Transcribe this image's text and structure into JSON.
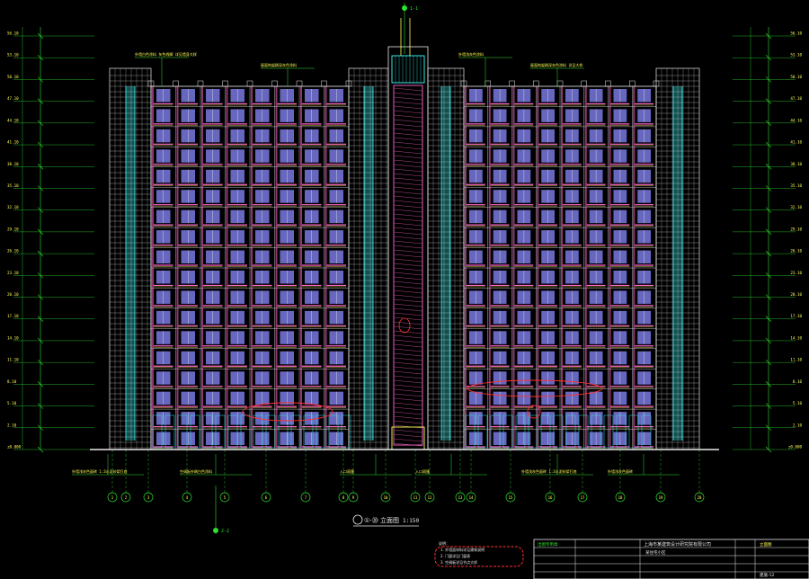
{
  "drawing": {
    "title": "①-⑳ 立面图",
    "scale": "1:150",
    "firm": "上海市某建筑设计研究院有限公司",
    "footnote_lines": [
      "说明：",
      "1. 外墙面材料详见建筑说明",
      "2. 门窗详见门窗表",
      "3. 空调板详见节点大样"
    ],
    "callouts_top": [
      "外墙白色涂料 灰色线脚 详见墙身大样",
      "屋面构架刷深灰色涂料",
      "外墙浅灰色涂料",
      "屋面构架刷深灰色涂料 详见大样"
    ],
    "callouts_bottom": [
      "外墙浅灰色面砖 1:3水泥砂浆打底",
      "空调板外刷白色涂料",
      "入口雨篷",
      "入口雨篷",
      "外墙浅灰色面砖 1:3水泥砂浆打底",
      "外墙浅灰色面砖"
    ],
    "section_markers": [
      "1-1",
      "2-2"
    ],
    "title_block": {
      "project": "某住宅小区",
      "sheet_name": "立面图",
      "sheet_no": "建施-12",
      "stamp": "出图专用章"
    }
  },
  "elevation_levels": {
    "left": [
      "56.10",
      "53.10",
      "50.10",
      "47.10",
      "44.10",
      "41.10",
      "38.10",
      "35.10",
      "32.10",
      "29.10",
      "26.10",
      "23.10",
      "20.10",
      "17.10",
      "14.10",
      "11.10",
      "8.10",
      "5.10",
      "2.10",
      "±0.000"
    ],
    "right": [
      "56.10",
      "53.10",
      "50.10",
      "47.10",
      "44.10",
      "41.10",
      "38.10",
      "35.10",
      "32.10",
      "29.10",
      "26.10",
      "23.10",
      "20.10",
      "17.10",
      "14.10",
      "11.10",
      "8.10",
      "5.10",
      "2.10",
      "±0.000"
    ]
  },
  "axis_labels": [
    "1",
    "2",
    "3",
    "4",
    "5",
    "6",
    "7",
    "8",
    "9",
    "10",
    "11",
    "12",
    "13",
    "14",
    "15",
    "16",
    "17",
    "18",
    "19",
    "20"
  ],
  "colors": {
    "background": "#000000",
    "grid_white": "#e8e8e8",
    "pink": "#ff66cc",
    "cyan": "#33e6e6",
    "green": "#2ee02e",
    "yellow": "#ffff55",
    "blue": "#8a8aff",
    "red": "#ff3030"
  }
}
